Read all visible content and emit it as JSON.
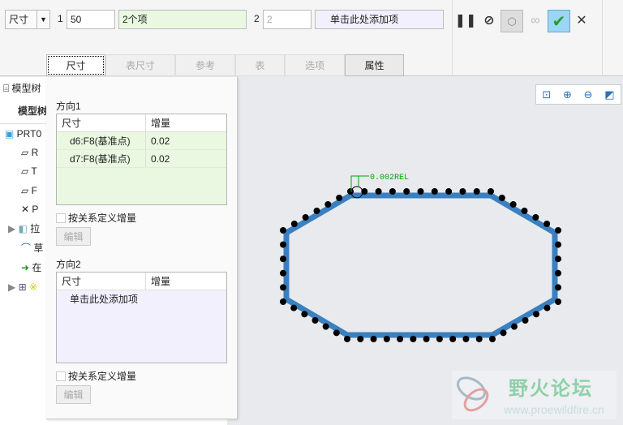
{
  "toolbar": {
    "type_select": "尺寸",
    "dir1_label": "1",
    "dir1_count": "50",
    "dir1_items": "2个项",
    "dir2_label": "2",
    "dir2_count": "2",
    "dir2_items": "单击此处添加项"
  },
  "tabs": [
    "尺寸",
    "表尺寸",
    "参考",
    "表",
    "选项",
    "属性"
  ],
  "tree": {
    "header": "模型树",
    "sub": "模型树",
    "items": [
      "PRT0",
      "R",
      "T",
      "F",
      "P",
      "拉",
      "草",
      "在",
      "※"
    ]
  },
  "panel": {
    "dir1_title": "方向1",
    "dir2_title": "方向2",
    "col_dim": "尺寸",
    "col_inc": "增量",
    "dir1_rows": [
      {
        "dim": "d6:F8(基准点)",
        "inc": "0.02"
      },
      {
        "dim": "d7:F8(基准点)",
        "inc": "0.02"
      }
    ],
    "dir2_placeholder": "单击此处添加项",
    "relation_checkbox": "按关系定义增量",
    "edit_button": "编辑"
  },
  "canvas": {
    "annotation": "0.002REL",
    "watermark_cn": "野火论坛",
    "watermark_url": "www.proewildfire.cn",
    "shape_color": "#3a80c0"
  }
}
